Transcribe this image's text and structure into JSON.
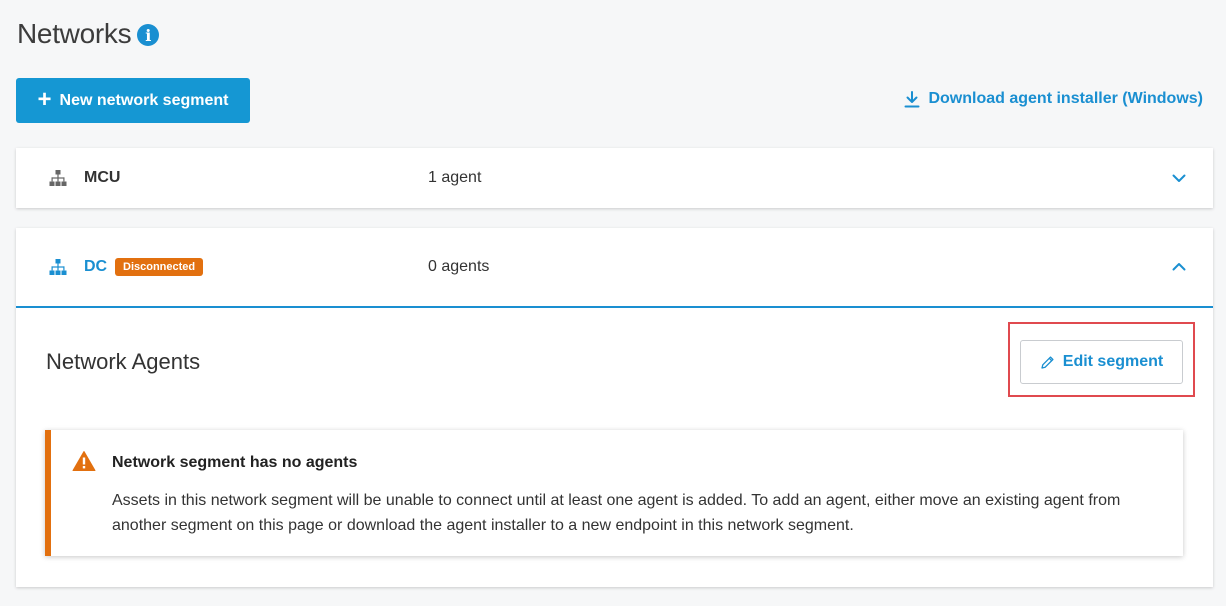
{
  "header": {
    "title": "Networks",
    "info_glyph": "i"
  },
  "actions": {
    "new_segment_label": "New network segment",
    "new_segment_icon": "plus-icon",
    "download_label": "Download agent installer (Windows)",
    "download_icon": "download-icon"
  },
  "segments": [
    {
      "name": "MCU",
      "agents": "1 agent",
      "expanded": false,
      "icon": "network-hierarchy-icon"
    },
    {
      "name": "DC",
      "status": "Disconnected",
      "agents": "0 agents",
      "expanded": true,
      "icon": "network-hierarchy-icon"
    }
  ],
  "details": {
    "section_title": "Network Agents",
    "edit_label": "Edit segment",
    "edit_icon": "pencil-icon"
  },
  "alert": {
    "title": "Network segment has no agents",
    "body": "Assets in this network segment will be unable to connect until at least one agent is added. To add an agent, either move an existing agent from another segment on this page or download the agent installer to a new endpoint in this network segment.",
    "icon": "warning-icon"
  },
  "colors": {
    "accent": "#1a8fd1",
    "button": "#1597d3",
    "warning": "#e2700f",
    "highlight": "#e04a4f"
  }
}
